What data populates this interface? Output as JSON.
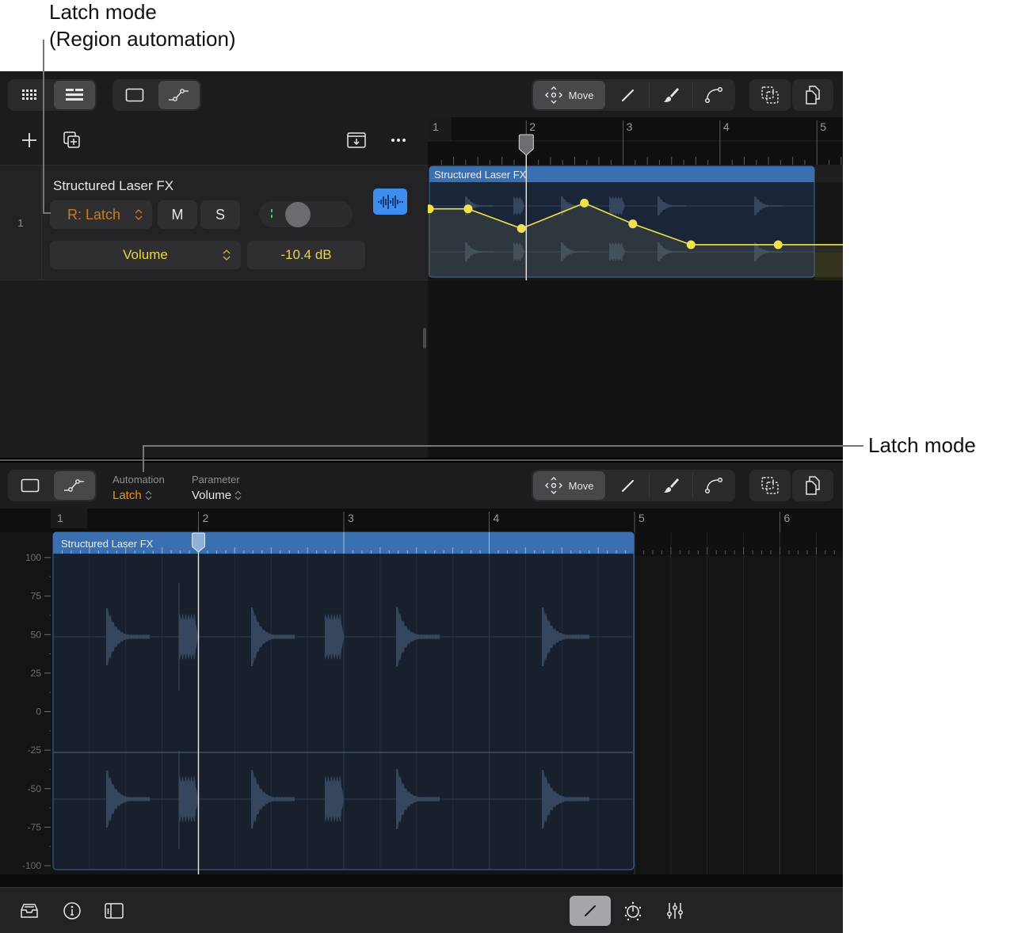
{
  "callouts": {
    "region_latch_line1": "Latch mode",
    "region_latch_line2": "(Region automation)",
    "latch_mode": "Latch mode"
  },
  "top_toolbar": {
    "view_buttons": [
      {
        "icon": "grid-icon",
        "active": false
      },
      {
        "icon": "tracks-list-icon",
        "active": true
      }
    ],
    "mode_buttons": [
      {
        "icon": "region-rectangle-icon",
        "active": false
      },
      {
        "icon": "automation-curve-icon",
        "active": true
      }
    ],
    "tools": {
      "move_label": "Move",
      "items": [
        "move-icon",
        "pencil-icon",
        "brush-icon",
        "curve-icon"
      ]
    },
    "extra": [
      "marquee-select-icon",
      "copy-icon"
    ]
  },
  "track_actions": {
    "add": "plus-icon",
    "duplicate": "duplicate-track-icon",
    "import": "import-icon",
    "more": "more-icon"
  },
  "track": {
    "number": "1",
    "name": "Structured Laser FX",
    "automation_mode": "R: Latch",
    "mute_label": "M",
    "solo_label": "S",
    "parameter": "Volume",
    "value": "-10.4 dB",
    "colors": {
      "latch": "#c87c1c",
      "param": "#e8d44a",
      "region_button": "#3d8ef0"
    }
  },
  "top_timeline": {
    "bars": [
      "1",
      "2",
      "3",
      "4",
      "5"
    ],
    "region_name": "Structured Laser FX",
    "playhead_bar": 2.0,
    "automation_points": [
      {
        "bar": 1.0,
        "value": 0.55
      },
      {
        "bar": 1.4,
        "value": 0.55
      },
      {
        "bar": 1.95,
        "value": 0.38
      },
      {
        "bar": 2.6,
        "value": 0.6
      },
      {
        "bar": 3.1,
        "value": 0.42
      },
      {
        "bar": 3.7,
        "value": 0.24
      },
      {
        "bar": 4.6,
        "value": 0.24
      }
    ],
    "automation_color": "#f2e14c"
  },
  "lower_toolbar": {
    "mode_buttons": [
      {
        "icon": "region-rectangle-icon",
        "active": false
      },
      {
        "icon": "automation-curve-icon",
        "active": true
      }
    ],
    "automation_label": "Automation",
    "automation_value": "Latch",
    "parameter_label": "Parameter",
    "parameter_value": "Volume",
    "move_label": "Move"
  },
  "editor": {
    "bars": [
      "1",
      "2",
      "3",
      "4",
      "5",
      "6"
    ],
    "region_name": "Structured Laser FX",
    "y_ticks": [
      "100",
      "75",
      "50",
      "25",
      "0",
      "-25",
      "-50",
      "-75",
      "-100"
    ],
    "playhead_bar": 2.0
  },
  "bottom_bar": {
    "left": [
      "inbox-icon",
      "info-icon",
      "library-panel-icon"
    ],
    "right": [
      {
        "icon": "pencil-icon",
        "active": true
      },
      {
        "icon": "metronome-knob-icon",
        "active": false
      },
      {
        "icon": "mixer-sliders-icon",
        "active": false
      }
    ]
  }
}
